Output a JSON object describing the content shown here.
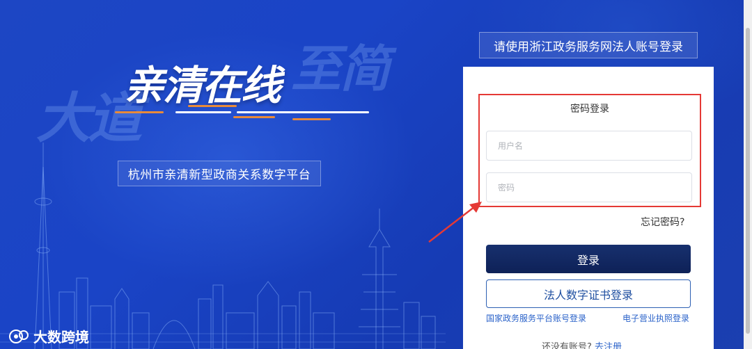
{
  "hero": {
    "title": "亲清在线",
    "ghost_left": "大道",
    "ghost_right": "至简",
    "platform_name": "杭州市亲清新型政商关系数字平台"
  },
  "banner": {
    "label": "请使用浙江政务服务网法人账号登录"
  },
  "login": {
    "title": "密码登录",
    "username_placeholder": "用户名",
    "password_placeholder": "密码",
    "forgot": "忘记密码?",
    "submit": "登录",
    "cert_login": "法人数字证书登录",
    "link_national": "国家政务服务平台账号登录",
    "link_license": "电子营业执照登录",
    "no_account": "还没有账号?",
    "register": "去注册"
  },
  "watermark": {
    "text": "大数跨境"
  },
  "colors": {
    "bg": "#1a44c6",
    "primary_btn": "#17306e",
    "link": "#2a62c9",
    "annotation": "#e53935",
    "accent_orange": "#e88a3a"
  }
}
